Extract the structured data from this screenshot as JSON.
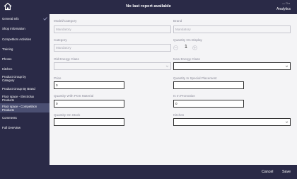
{
  "header": {
    "title": "No last report available",
    "device_hint": "— □ ×",
    "app_label": "Analytics"
  },
  "sidebar": {
    "items": [
      {
        "label": "General Info",
        "checked": true
      },
      {
        "label": "Shop Information"
      },
      {
        "label": "Competitors Activities"
      },
      {
        "label": "Training"
      },
      {
        "label": "Photos"
      },
      {
        "label": "Kitchen"
      },
      {
        "label": "Product Group by Category"
      },
      {
        "label": "Product Group By Brand"
      },
      {
        "label": "Floor space - Electrolux Products"
      },
      {
        "label": "Floor space - Competition Products",
        "active": true
      },
      {
        "label": "Comments"
      },
      {
        "label": "Full Overview"
      }
    ]
  },
  "form": {
    "model_category": {
      "label": "Model/Category",
      "placeholder": "Mandatory"
    },
    "brand": {
      "label": "Brand",
      "placeholder": "Mandatory"
    },
    "category": {
      "label": "Category",
      "placeholder": "Mandatory"
    },
    "quantity_on_display": {
      "label": "Quantity On Display",
      "value": "1"
    },
    "old_energy_class": {
      "label": "Old Energy Class",
      "value": ""
    },
    "new_energy_class": {
      "label": "New Energy Class",
      "value": ""
    },
    "price": {
      "label": "Price",
      "value": "0"
    },
    "quantity_special_placement": {
      "label": "Quantity In Special Placement",
      "value": ""
    },
    "quantity_pos_material": {
      "label": "Quantity With POS Material",
      "value": "0"
    },
    "is_in_promotion": {
      "label": "Is In Promotion",
      "value": "0"
    },
    "quantity_on_stock": {
      "label": "Quantity On Stock",
      "value": ""
    },
    "kitchen": {
      "label": "Kitchen",
      "value": ""
    }
  },
  "footer": {
    "cancel_label": "Cancel",
    "save_label": "Save"
  },
  "colors": {
    "sidebar_bg": "#2a2a47",
    "active_item_bg": "#4b4f72",
    "content_bg": "#f4f4f6"
  }
}
